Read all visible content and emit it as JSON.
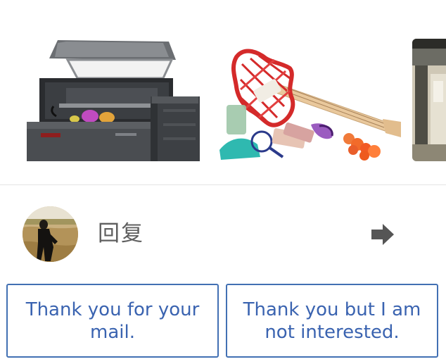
{
  "attachments": [
    {
      "name": "3d-printer-image",
      "icon": "printer-image"
    },
    {
      "name": "3d-printed-guitar-image",
      "icon": "guitar-image"
    },
    {
      "name": "third-attachment-image-partial",
      "icon": "image"
    }
  ],
  "reply": {
    "avatar_icon": "user-avatar",
    "label": "回复",
    "send_icon": "arrow-right-icon"
  },
  "smart_replies": [
    "Thank you for your mail.",
    "Thank you but I am not interested."
  ],
  "colors": {
    "accent": "#3a63b0",
    "button_border": "#4270b3",
    "label": "#5f5f5f",
    "arrow": "#555555",
    "divider": "#e4e4e4"
  }
}
